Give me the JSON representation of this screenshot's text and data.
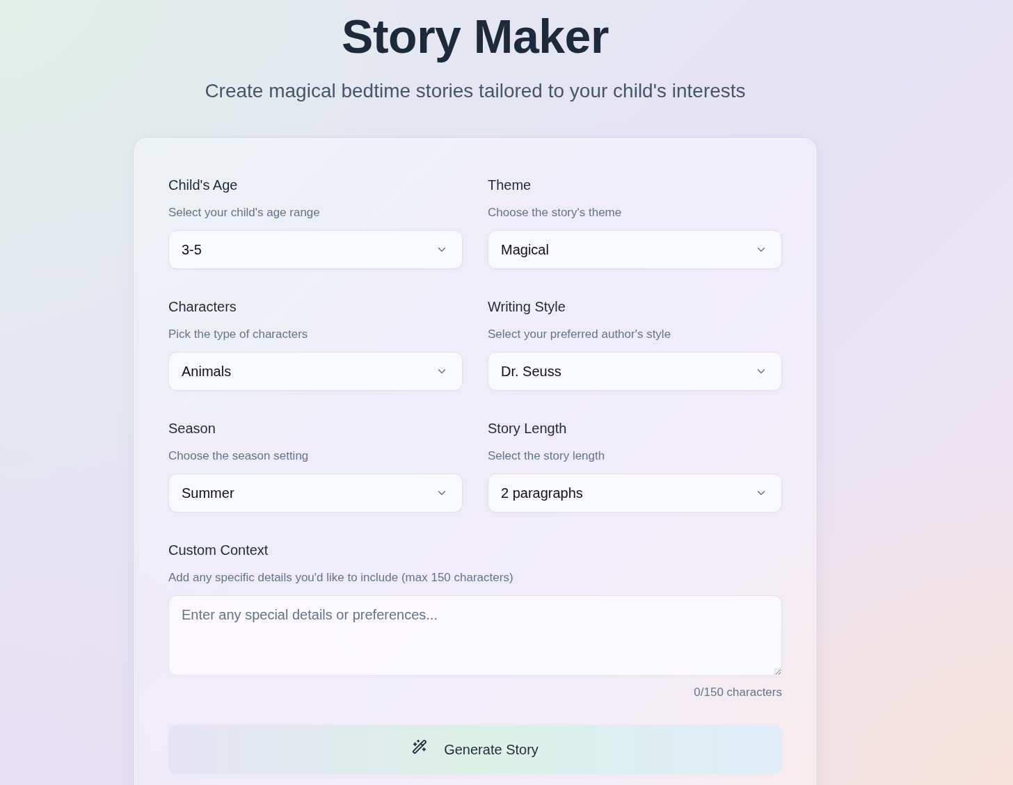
{
  "header": {
    "title": "Story Maker",
    "subtitle": "Create magical bedtime stories tailored to your child's interests"
  },
  "form": {
    "fields": [
      {
        "label": "Child's Age",
        "help": "Select your child's age range",
        "value": "3-5"
      },
      {
        "label": "Theme",
        "help": "Choose the story's theme",
        "value": "Magical"
      },
      {
        "label": "Characters",
        "help": "Pick the type of characters",
        "value": "Animals"
      },
      {
        "label": "Writing Style",
        "help": "Select your preferred author's style",
        "value": "Dr. Seuss"
      },
      {
        "label": "Season",
        "help": "Choose the season setting",
        "value": "Summer"
      },
      {
        "label": "Story Length",
        "help": "Select the story length",
        "value": "2 paragraphs"
      }
    ],
    "custom_context": {
      "label": "Custom Context",
      "help": "Add any specific details you'd like to include (max 150 characters)",
      "placeholder": "Enter any special details or preferences...",
      "counter": "0/150 characters"
    },
    "submit": {
      "label": "Generate Story"
    }
  }
}
